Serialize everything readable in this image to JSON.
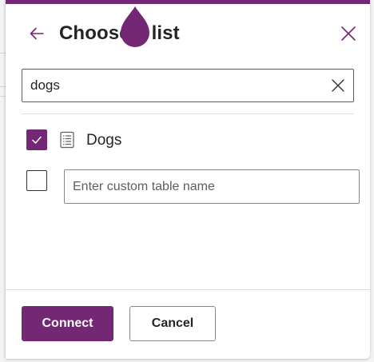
{
  "panel": {
    "title": "Choose a list",
    "accent_color": "#742774"
  },
  "search": {
    "value": "dogs",
    "placeholder": ""
  },
  "results": [
    {
      "label": "Dogs",
      "checked": true,
      "icon": "list-icon"
    }
  ],
  "custom_table": {
    "checked": false,
    "value": "",
    "placeholder": "Enter custom table name"
  },
  "footer": {
    "connect_label": "Connect",
    "cancel_label": "Cancel"
  },
  "icons": {
    "back": "arrow-left-icon",
    "close": "close-icon",
    "clear": "clear-icon",
    "drop": "drop-icon",
    "check": "checkmark-icon"
  }
}
